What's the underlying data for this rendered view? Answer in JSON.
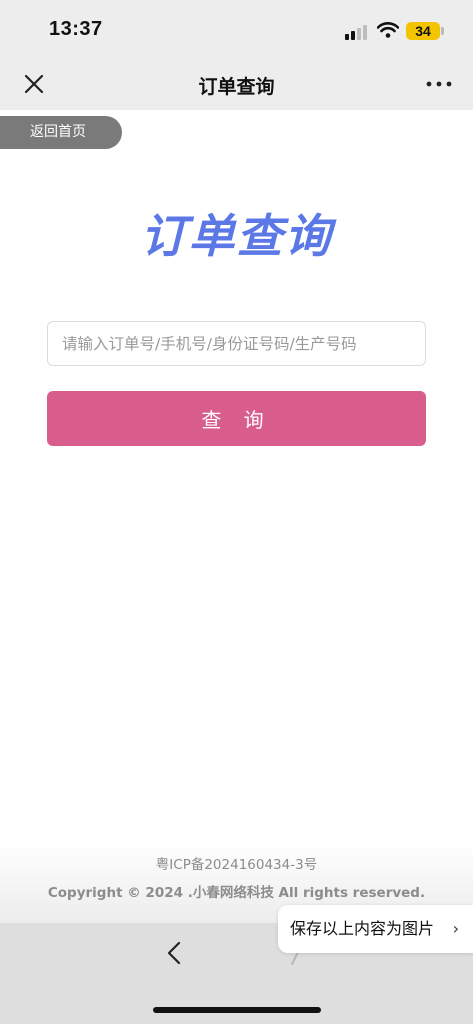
{
  "status": {
    "time": "13:37",
    "battery": "34"
  },
  "nav": {
    "title": "订单查询"
  },
  "back_home_label": "返回首页",
  "brand_title": "订单查询",
  "search": {
    "placeholder": "请输入订单号/手机号/身份证号码/生产号码",
    "value": ""
  },
  "query_button_label": "查 询",
  "footer": {
    "icp": "粤ICP备2024160434-3号",
    "copyright": "Copyright © 2024 .小春网络科技 All rights reserved."
  },
  "save_tooltip": {
    "label": "保存以上内容为图片",
    "chevron": "›"
  },
  "icons": [
    "close-icon",
    "more-icon",
    "signal-icon",
    "wifi-icon",
    "battery-icon",
    "back-arrow-icon",
    "forward-arrow-icon",
    "chevron-right-icon"
  ],
  "colors": {
    "brand": "#5b78e6",
    "button": "#d95d8c",
    "bar": "#ededed"
  }
}
